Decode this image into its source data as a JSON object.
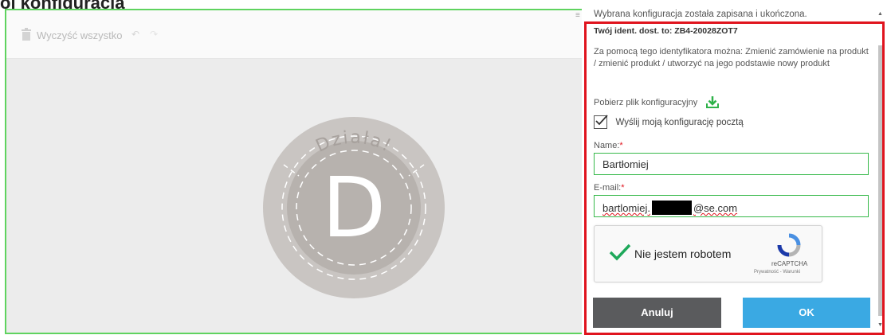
{
  "page": {
    "cut_title": "ój konfiguracjа"
  },
  "toolbar": {
    "clear_label": "Wyczyść wszystko",
    "undo_icon": "undo-icon",
    "redo_icon": "redo-icon"
  },
  "preview": {
    "badge_top_text": "Działa!",
    "badge_letter": "D",
    "badge_outer_color": "#c9c5c2",
    "badge_inner_color": "#b7b2ae"
  },
  "modal": {
    "saved_message": "Wybrana konfiguracja została zapisana i ukończona.",
    "ident_text": "Twój ident. dost. to: ZB4-20028ZOT7",
    "info_text": "Za pomocą tego identyfikatora można: Zmienić zamówienie na produkt / zmienić produkt / utworzyć na jego podstawie nowy produkt",
    "download_label": "Pobierz plik konfiguracyjny",
    "send_mail_label": "Wyślij moją konfigurację pocztą",
    "send_mail_checked": true,
    "name_label": "Name:",
    "name_value": "Bartłomiej",
    "email_label": "E-mail:",
    "email_prefix": "bartlomiej.",
    "email_suffix": "@se.com",
    "required_mark": "*",
    "captcha_label": "Nie jestem robotem",
    "captcha_brand": "reCAPTCHA",
    "captcha_links": "Prywatność - Warunki",
    "cancel_label": "Anuluj",
    "ok_label": "OK"
  },
  "colors": {
    "accent_ok": "#3aa9e3",
    "cancel_bg": "#5a5b5d",
    "valid_green": "#36b94a",
    "highlight_red": "#e0141e",
    "frame_green": "#5fd35f"
  }
}
